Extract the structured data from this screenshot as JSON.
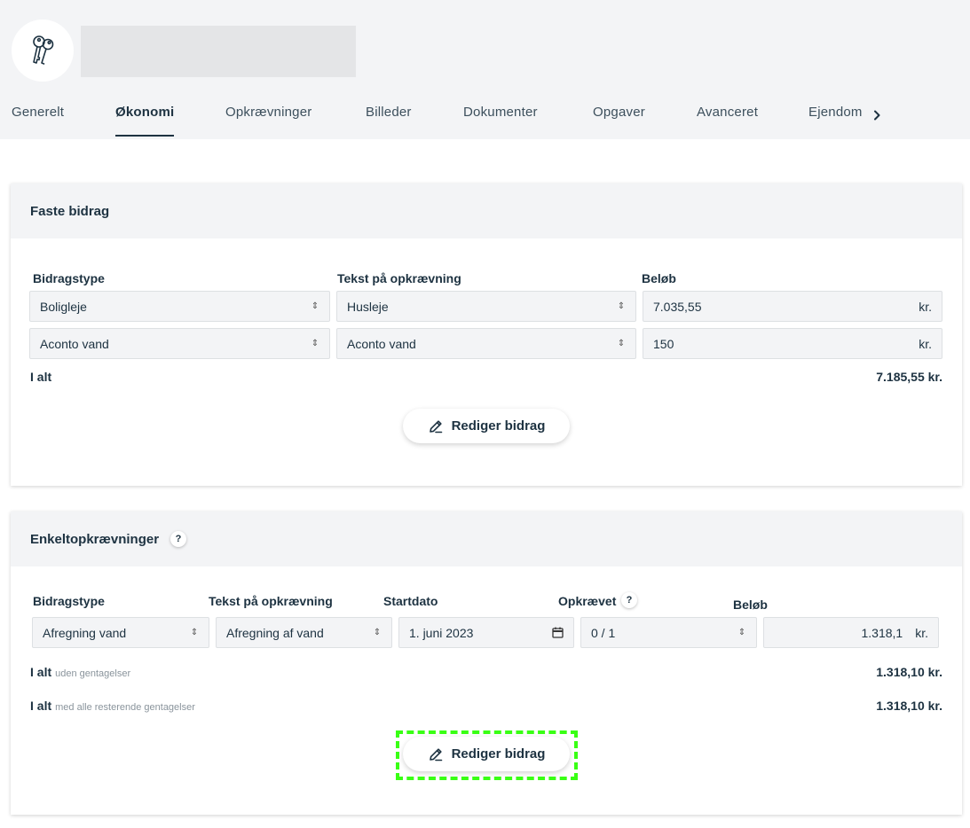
{
  "header": {
    "avatar_icon": "keys-icon"
  },
  "tabs": [
    {
      "label": "Generelt",
      "active": false
    },
    {
      "label": "Økonomi",
      "active": true
    },
    {
      "label": "Opkrævninger",
      "active": false
    },
    {
      "label": "Billeder",
      "active": false
    },
    {
      "label": "Dokumenter",
      "active": false
    },
    {
      "label": "Opgaver",
      "active": false
    },
    {
      "label": "Avanceret",
      "active": false
    },
    {
      "label": "Ejendom",
      "active": false
    }
  ],
  "faste": {
    "title": "Faste bidrag",
    "col_type": "Bidragstype",
    "col_text": "Tekst på opkrævning",
    "col_amount": "Beløb",
    "rows": [
      {
        "type": "Boligleje",
        "text": "Husleje",
        "amount": "7.035,55",
        "unit": "kr."
      },
      {
        "type": "Aconto vand",
        "text": "Aconto vand",
        "amount": "150",
        "unit": "kr."
      }
    ],
    "total_label": "I alt",
    "total_value": "7.185,55 kr.",
    "edit_button": "Rediger bidrag"
  },
  "enkelt": {
    "title": "Enkeltopkrævninger",
    "help": "?",
    "col_type": "Bidragstype",
    "col_text": "Tekst på opkrævning",
    "col_start": "Startdato",
    "col_charged": "Opkrævet",
    "col_amount": "Beløb",
    "row": {
      "type": "Afregning vand",
      "text": "Afregning af vand",
      "start": "1. juni 2023",
      "charged": "0 / 1",
      "amount": "1.318,1",
      "unit": "kr."
    },
    "total1_label": "I alt",
    "total1_sub": "uden gentagelser",
    "total1_value": "1.318,10 kr.",
    "total2_label": "I alt",
    "total2_sub": "med alle resterende gentagelser",
    "total2_value": "1.318,10 kr.",
    "edit_button": "Rediger bidrag"
  }
}
